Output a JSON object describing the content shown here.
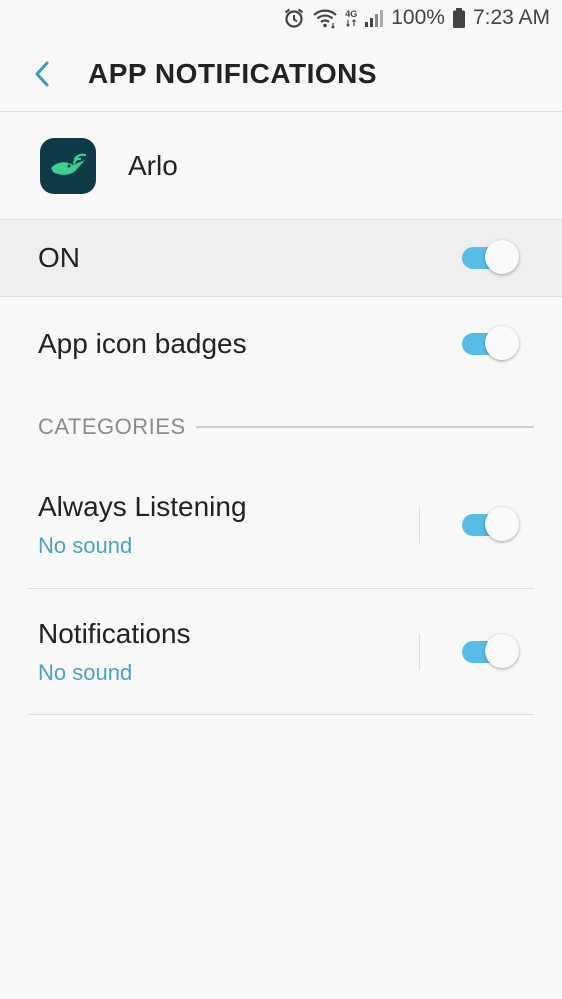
{
  "status_bar": {
    "icons": [
      "alarm-icon",
      "wifi-icon",
      "4g-icon",
      "signal-icon",
      "battery-icon"
    ],
    "network_label": "4G",
    "battery": "100%",
    "time": "7:23 AM"
  },
  "app_bar": {
    "title": "APP NOTIFICATIONS"
  },
  "app": {
    "name": "Arlo",
    "icon": "arlo-bird-icon",
    "icon_bg": "#0f3a48",
    "icon_fg": "#3ccf91"
  },
  "master": {
    "label": "ON",
    "enabled": true
  },
  "badges": {
    "label": "App icon badges",
    "enabled": true
  },
  "categories": {
    "header": "CATEGORIES",
    "items": [
      {
        "title": "Always Listening",
        "subtitle": "No sound",
        "enabled": true
      },
      {
        "title": "Notifications",
        "subtitle": "No sound",
        "enabled": true
      }
    ]
  },
  "colors": {
    "accent": "#57bde6",
    "subtitle": "#4aa3bf",
    "back_arrow": "#3d9ac0"
  }
}
